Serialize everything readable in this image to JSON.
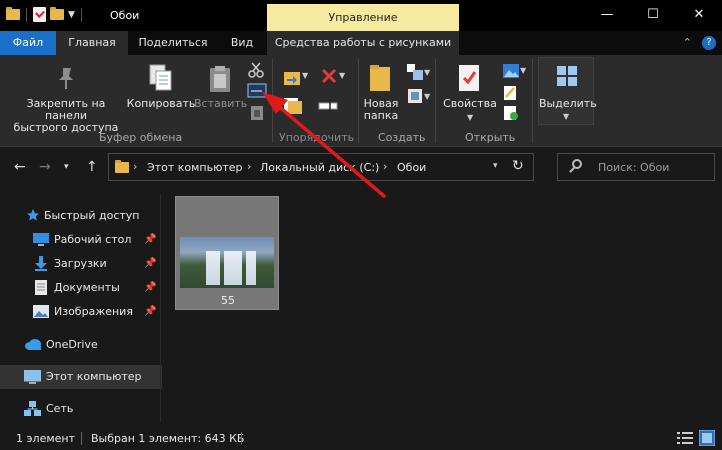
{
  "window": {
    "title": "Обои",
    "contextual_tab": "Управление",
    "controls": {
      "minimize": "—",
      "maximize": "☐",
      "close": "✕"
    },
    "accent_color": "#1a6fc9",
    "contextual_color": "#f6e9a0"
  },
  "tabs": {
    "file": "Файл",
    "home": "Главная",
    "share": "Поделиться",
    "view": "Вид",
    "picture_tools": "Средства работы с рисунками"
  },
  "ribbon": {
    "pin_label_line1": "Закрепить на панели",
    "pin_label_line2": "быстрого доступа",
    "copy_label": "Копировать",
    "paste_label": "Вставить",
    "group_clipboard": "Буфер обмена",
    "group_organize": "Упорядочить",
    "new_folder_line1": "Новая",
    "new_folder_line2": "папка",
    "group_create": "Создать",
    "properties_label": "Свойства",
    "group_open": "Открыть",
    "select_label": "Выделить"
  },
  "address": {
    "crumbs": [
      "Этот компьютер",
      "Локальный диск (C:)",
      "Обои"
    ],
    "search_placeholder": "Поиск: Обои"
  },
  "sidebar": {
    "items": [
      {
        "label": "Быстрый доступ",
        "icon": "star-icon"
      },
      {
        "label": "Рабочий стол",
        "icon": "desktop-icon",
        "pinned": true
      },
      {
        "label": "Загрузки",
        "icon": "download-icon",
        "pinned": true
      },
      {
        "label": "Документы",
        "icon": "document-icon",
        "pinned": true
      },
      {
        "label": "Изображения",
        "icon": "pictures-icon",
        "pinned": true
      },
      {
        "label": "OneDrive",
        "icon": "cloud-icon"
      },
      {
        "label": "Этот компьютер",
        "icon": "computer-icon",
        "selected": true
      },
      {
        "label": "Сеть",
        "icon": "network-icon"
      }
    ]
  },
  "content": {
    "files": [
      {
        "name": "55",
        "type": "image"
      }
    ]
  },
  "status": {
    "count": "1 элемент",
    "selection": "Выбран 1 элемент: 643 КБ"
  }
}
